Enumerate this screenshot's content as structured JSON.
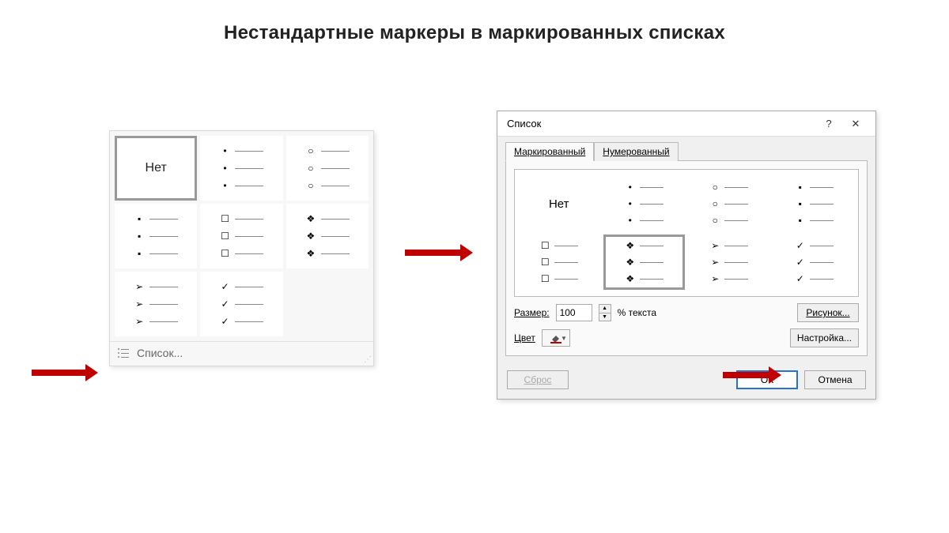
{
  "title": "Нестандартные маркеры в маркированных списках",
  "dropdown": {
    "none_label": "Нет",
    "list_link": "Список..."
  },
  "dialog": {
    "title": "Список",
    "help_symbol": "?",
    "close_symbol": "✕",
    "tabs": {
      "bulleted": "Маркированный",
      "numbered": "Нумерованный"
    },
    "preview": {
      "none_label": "Нет"
    },
    "size_label": "Размер:",
    "size_value": "100",
    "size_unit": "% текста",
    "color_label": "Цвет",
    "picture_btn": "Рисунок...",
    "customize_btn": "Настройка...",
    "reset_btn": "Сброс",
    "ok_btn": "ОК",
    "cancel_btn": "Отмена"
  }
}
